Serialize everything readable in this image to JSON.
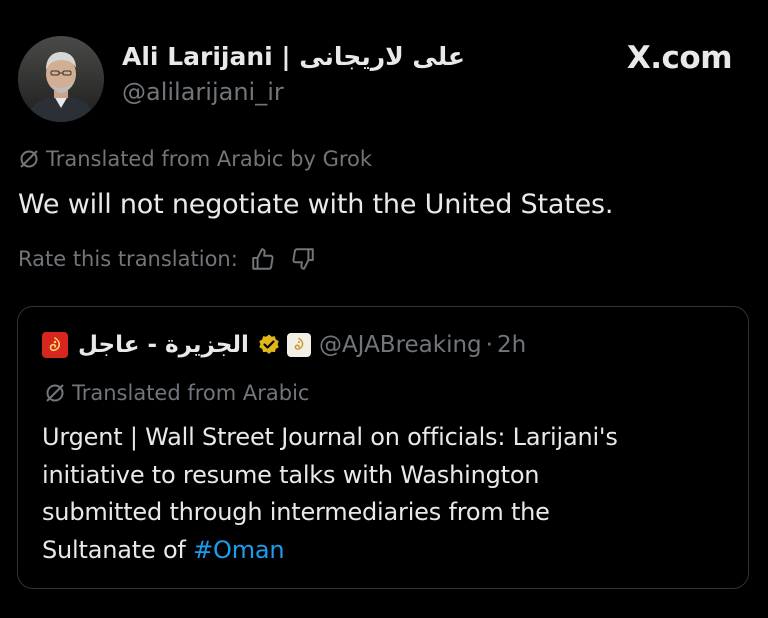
{
  "tweet": {
    "author": {
      "display_name": "Ali Larijani | علی لاریجانی",
      "handle": "@alilarijani_ir"
    },
    "brand": "X.com",
    "translation_notice": "Translated from Arabic by Grok",
    "text": "We will not negotiate with the United States.",
    "rate_label": "Rate this translation:"
  },
  "quote": {
    "name": "الجزيرة - عاجل",
    "handle": "@AJABreaking",
    "separator": "·",
    "time": "2h",
    "translation_notice": "Translated from Arabic",
    "body_lines": [
      "Urgent | Wall Street Journal on officials: Larijani's",
      "initiative to resume talks with Washington",
      "submitted through intermediaries from the",
      "Sultanate of "
    ],
    "hashtag": "#Oman"
  },
  "colors": {
    "background": "#000000",
    "text_primary": "#e7e9ea",
    "text_secondary": "#71767b",
    "link": "#1d9bf0",
    "verified_gold": "#e2b719",
    "aljazeera_red": "#d7261e",
    "card_border": "#2f3336"
  },
  "icons": {
    "translate": "slashed-circle-icon",
    "like": "thumbs-up-icon",
    "dislike": "thumbs-down-icon",
    "verified": "gold-verified-badge-icon",
    "logo": "aljazeera-logo-icon"
  }
}
